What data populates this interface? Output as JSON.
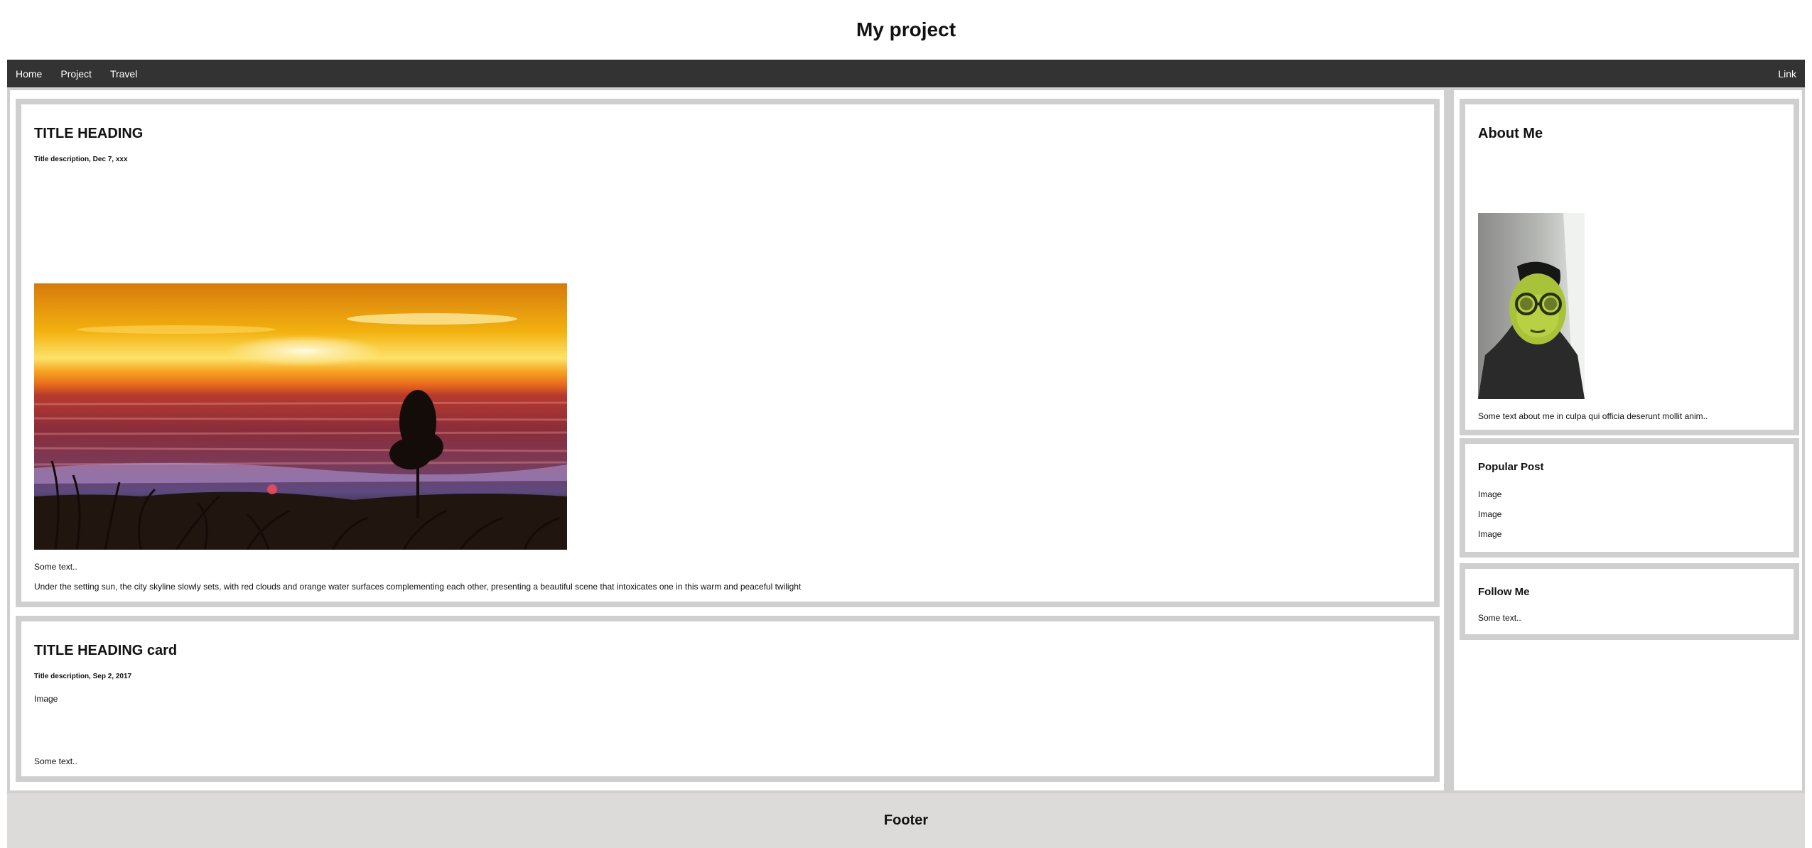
{
  "header": {
    "title": "My project"
  },
  "nav": {
    "items": [
      {
        "label": "Home"
      },
      {
        "label": "Project"
      },
      {
        "label": "Travel"
      }
    ],
    "right_link": "Link"
  },
  "main": {
    "cards": [
      {
        "title": "TITLE HEADING",
        "subtitle": "Title description, Dec 7, xxx",
        "image": "sunset-beach-photo",
        "text1": "Some text..",
        "text2": "Under the setting sun, the city skyline slowly sets, with red clouds and orange water surfaces complementing each other, presenting a beautiful scene that intoxicates one in this warm and peaceful twilight"
      },
      {
        "title": "TITLE HEADING card",
        "subtitle": "Title description, Sep 2, 2017",
        "image_label": "Image",
        "text": "Some text.."
      }
    ]
  },
  "sidebar": {
    "about": {
      "title": "About Me",
      "avatar": "profile-photo",
      "text": "Some text about me in culpa qui officia deserunt mollit anim.."
    },
    "popular": {
      "title": "Popular Post",
      "items": [
        "Image",
        "Image",
        "Image"
      ]
    },
    "follow": {
      "title": "Follow Me",
      "text": "Some text.."
    }
  },
  "footer": {
    "label": "Footer"
  },
  "colors": {
    "nav_bg": "#333333",
    "gutter": "#cfcfcf",
    "footer_bg": "#dddbda"
  }
}
